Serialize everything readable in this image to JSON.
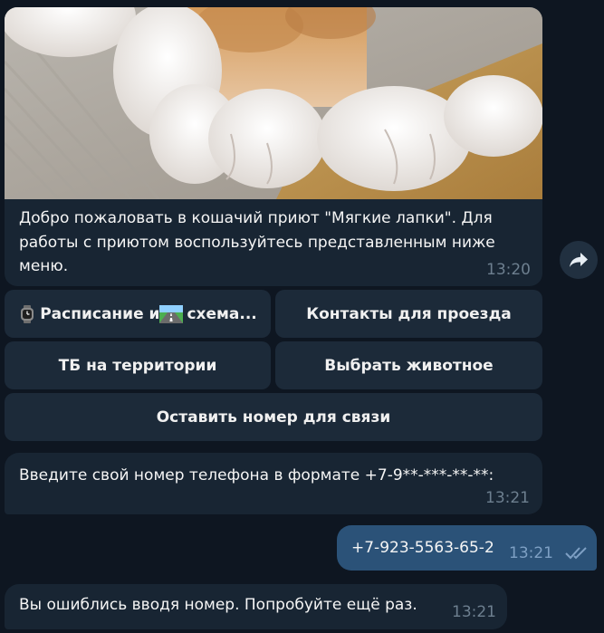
{
  "messages": {
    "welcome": {
      "text": "Добро пожаловать в кошачий приют \"Мягкие лапки\". Для работы с приютом воспользуйтесь представленным ниже меню.",
      "time": "13:20",
      "image": "cat-paws-photo"
    },
    "prompt": {
      "text": "Введите свой номер телефона в формате +7-9**-***-**-**:",
      "time": "13:21"
    },
    "user_reply": {
      "text": "+7-923-5563-65-2",
      "time": "13:21",
      "status_icon": "double-check-icon"
    },
    "error": {
      "text": "Вы ошиблись вводя номер. Попробуйте ещё раз.",
      "time": "13:21"
    }
  },
  "keyboard": {
    "schedule_part1": "Расписание и ",
    "schedule_part2": "схема...",
    "contacts": "Контакты для проезда",
    "safety": "ТБ на территории",
    "choose_animal": "Выбрать животное",
    "leave_number": "Оставить номер для связи"
  },
  "icons": {
    "share": "share-arrow-icon",
    "watch": "watch-emoji-icon",
    "road": "motorway-emoji-icon"
  },
  "colors": {
    "background": "#0e1621",
    "incoming_bubble": "#182533",
    "outgoing_bubble": "#2b5278",
    "keyboard_button": "#1c2a39",
    "timestamp": "#6d7f8f",
    "check_marks": "#7ea0c4"
  }
}
